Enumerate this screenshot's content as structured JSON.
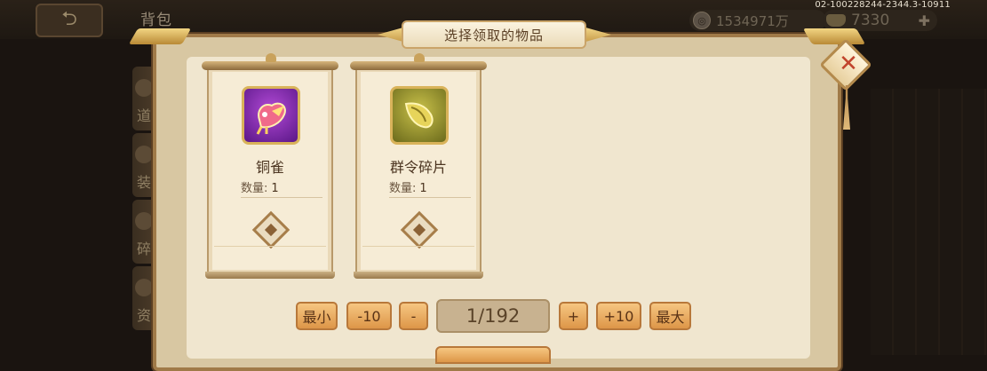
{
  "background": {
    "bag_title": "背包",
    "currency_silver": "1534971万",
    "currency_gold": "7330",
    "version": "02-100228244-2344.3-10911",
    "side_tabs": [
      "道",
      "装",
      "碎",
      "资"
    ]
  },
  "dialog": {
    "title": "选择领取的物品"
  },
  "items": [
    {
      "name": "铜雀",
      "qty_label": "数量:",
      "qty": "1",
      "icon": "phoenix-bird-icon",
      "rarity_color": "#8e2bb8"
    },
    {
      "name": "群令碎片",
      "qty_label": "数量:",
      "qty": "1",
      "icon": "token-fragment-icon",
      "rarity_color": "#a8a232"
    }
  ],
  "controls": {
    "min": "最小",
    "minus10": "-10",
    "minus": "-",
    "count": "1/192",
    "plus": "+",
    "plus10": "+10",
    "max": "最大"
  },
  "colors": {
    "accent": "#dd9648",
    "dialog_bg": "#f0e6cf",
    "close_x": "#c1432c"
  }
}
